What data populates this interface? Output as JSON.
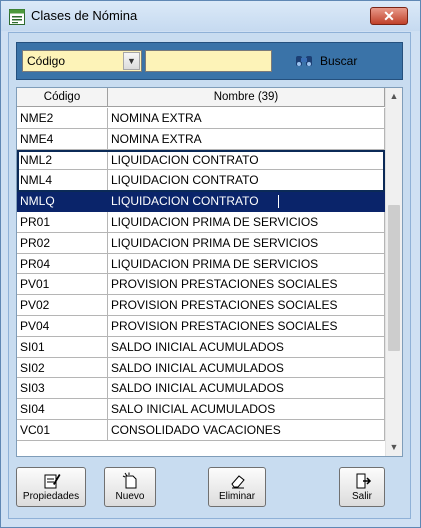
{
  "window": {
    "title": "Clases de Nómina",
    "close_label": "✕"
  },
  "search": {
    "field_selected": "Código",
    "input_value": "",
    "button_label": "Buscar"
  },
  "grid": {
    "columns": [
      "Código",
      "Nombre (39)"
    ],
    "rows": [
      {
        "code": "NME2",
        "name": "NOMINA EXTRA"
      },
      {
        "code": "NME4",
        "name": "NOMINA EXTRA"
      },
      {
        "code": "NML2",
        "name": "LIQUIDACION CONTRATO"
      },
      {
        "code": "NML4",
        "name": "LIQUIDACION CONTRATO"
      },
      {
        "code": "NMLQ",
        "name": "LIQUIDACION CONTRATO"
      },
      {
        "code": "PR01",
        "name": "LIQUIDACION PRIMA DE SERVICIOS"
      },
      {
        "code": "PR02",
        "name": "LIQUIDACION PRIMA DE SERVICIOS"
      },
      {
        "code": "PR04",
        "name": "LIQUIDACION PRIMA DE SERVICIOS"
      },
      {
        "code": "PV01",
        "name": "PROVISION PRESTACIONES SOCIALES"
      },
      {
        "code": "PV02",
        "name": "PROVISION PRESTACIONES SOCIALES"
      },
      {
        "code": "PV04",
        "name": "PROVISION PRESTACIONES SOCIALES"
      },
      {
        "code": "SI01",
        "name": "SALDO INICIAL ACUMULADOS"
      },
      {
        "code": "SI02",
        "name": "SALDO INICIAL ACUMULADOS"
      },
      {
        "code": "SI03",
        "name": "SALDO INICIAL ACUMULADOS"
      },
      {
        "code": "SI04",
        "name": "SALO INICIAL ACUMULADOS"
      },
      {
        "code": "VC01",
        "name": "CONSOLIDADO VACACIONES"
      }
    ],
    "selected_code": "NMLQ"
  },
  "buttons": {
    "properties": "Propiedades",
    "new": "Nuevo",
    "delete": "Eliminar",
    "exit": "Salir"
  },
  "icons": {
    "app": "window-icon",
    "search": "binoculars-icon",
    "properties": "edit-document-icon",
    "new": "new-document-icon",
    "delete": "eraser-icon",
    "exit": "exit-door-icon"
  },
  "colors": {
    "selection": "#0a246a",
    "input_background": "#fdf3b8",
    "toolbar": "#3a73a8",
    "close_button": "#c0412a"
  }
}
